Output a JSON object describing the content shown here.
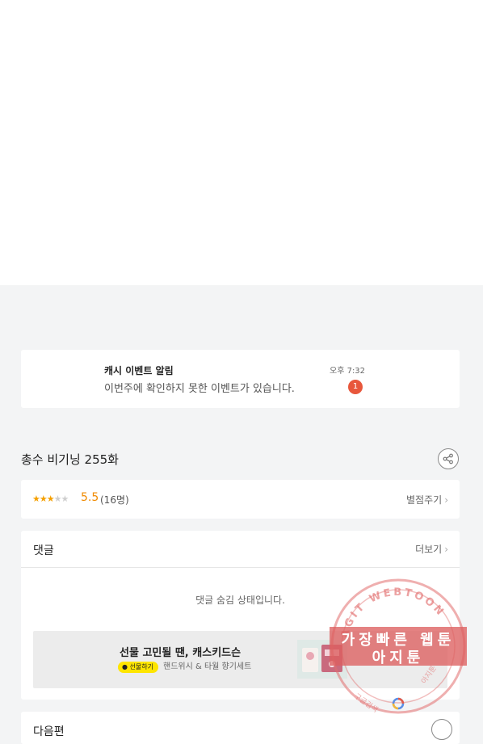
{
  "notification": {
    "title": "캐시 이벤트 알림",
    "message": "이번주에 확인하지 못한 이벤트가 있습니다.",
    "time": "오후 7:32",
    "badge": "1",
    "badge_color": "#e8573c"
  },
  "episode": {
    "title": "총수 비기닝 255화",
    "share_icon": "share-icon"
  },
  "rating": {
    "stars_filled": 3,
    "stars_total": 5,
    "score": "5.5",
    "count": "(16명)",
    "rate_link": "별점주기",
    "star_color": "#f5a000"
  },
  "comments": {
    "header": "댓글",
    "more": "더보기",
    "hidden_message": "댓글 숨김 상태입니다."
  },
  "ad": {
    "title": "선물 고민될 땐, 캐스키드슨",
    "pill": "선물하기",
    "subtitle": "핸드위시 & 타월 향기세트"
  },
  "next": {
    "label": "다음편"
  },
  "watermark": {
    "arc_text": "AGIT WEBTOON",
    "line1": "가장빠른 웹툰",
    "line2": "아지툰",
    "bottom_left": "구글검색",
    "bottom_right": "아지툰"
  }
}
